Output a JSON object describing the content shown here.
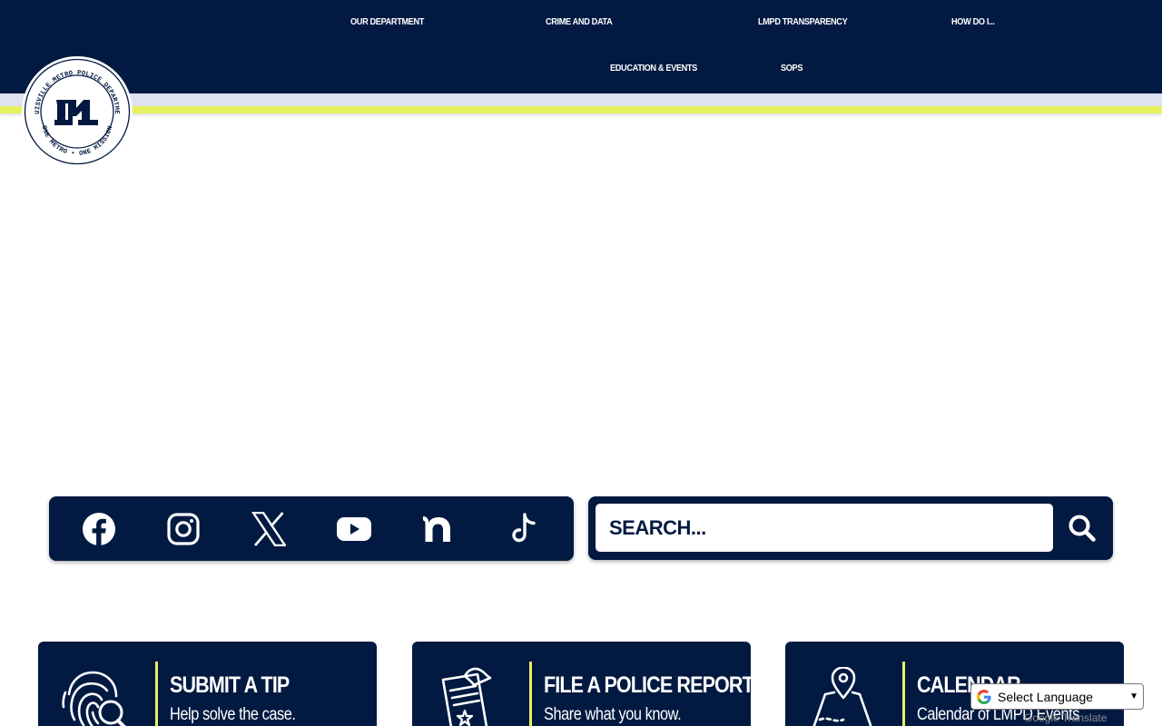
{
  "header": {
    "nav_row1": [
      "OUR DEPARTMENT",
      "CRIME AND DATA",
      "LMPD TRANSPARENCY",
      "HOW DO I..."
    ],
    "nav_row2": [
      "EDUCATION & EVENTS",
      "SOPS"
    ],
    "logo": {
      "ring_top_text": "LOUISVILLE METRO POLICE DEPARTMENT",
      "ring_bottom_text": "ONE METRO • ONE MISSION",
      "icon": "lmpd-monogram-icon"
    }
  },
  "social": {
    "items": [
      {
        "name": "facebook",
        "icon": "facebook-icon"
      },
      {
        "name": "instagram",
        "icon": "instagram-icon"
      },
      {
        "name": "x",
        "icon": "x-icon"
      },
      {
        "name": "youtube",
        "icon": "youtube-icon"
      },
      {
        "name": "nextdoor",
        "icon": "nextdoor-icon"
      },
      {
        "name": "tiktok",
        "icon": "tiktok-icon"
      }
    ]
  },
  "search": {
    "placeholder": "SEARCH...",
    "icon": "search-icon"
  },
  "cards": [
    {
      "title": "SUBMIT A TIP",
      "subtitle": "Help solve the case.",
      "icon": "fingerprint-search-icon"
    },
    {
      "title": "FILE A POLICE REPORT",
      "subtitle": "Share what you know.",
      "icon": "report-document-icon"
    },
    {
      "title": "CALENDAR",
      "subtitle": "Calendar of LMPD Events",
      "icon": "map-pin-icon"
    }
  ],
  "translate": {
    "label": "Select Language",
    "powered_by": "Google Translate",
    "icon": "google-g-icon"
  },
  "colors": {
    "navy": "#021a41",
    "accent_yellow": "#e6f25e",
    "lavender": "#dfe2f3"
  }
}
